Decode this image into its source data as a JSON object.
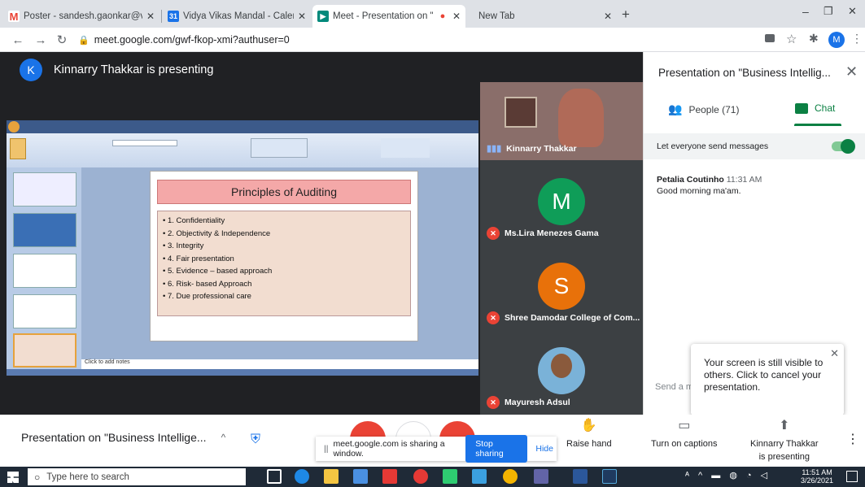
{
  "browser": {
    "tabs": [
      {
        "title": "Poster - sandesh.gaonkar@vvm.e",
        "icon": "gmail-icon"
      },
      {
        "title": "Vidya Vikas Mandal - Calendar -",
        "icon": "calendar-icon"
      },
      {
        "title": "Meet - Presentation on \"Busi",
        "icon": "meet-icon"
      },
      {
        "title": "New Tab",
        "icon": ""
      }
    ],
    "url": "meet.google.com/gwf-fkop-xmi?authuser=0",
    "profile_initial": "M"
  },
  "stage": {
    "presenting_initial": "K",
    "presenting_label": "Kinnarry Thakkar is presenting"
  },
  "slide": {
    "title": "Principles of Auditing",
    "bullets": [
      "• 1. Confidentiality",
      "• 2. Objectivity & Independence",
      "• 3. Integrity",
      "• 4. Fair presentation",
      "• 5. Evidence – based approach",
      "• 6. Risk- based Approach",
      "• 7. Due professional care"
    ],
    "notes": "Click to add notes"
  },
  "participants": [
    {
      "name": "Kinnarry Thakkar",
      "initial": "",
      "color": ""
    },
    {
      "name": "Ms.Lira Menezes Gama",
      "initial": "M",
      "color": "#0f9d58"
    },
    {
      "name": "Shree Damodar College of Com...",
      "initial": "S",
      "color": "#e8710a"
    },
    {
      "name": "Mayuresh Adsul",
      "initial": "",
      "color": ""
    }
  ],
  "panel": {
    "title": "Presentation on \"Business Intellig...",
    "people_tab": "People (71)",
    "chat_tab": "Chat",
    "allow_label": "Let everyone send messages",
    "message": {
      "sender": "Petalia Coutinho",
      "time": "11:31 AM",
      "text": "Good morning ma'am."
    },
    "send_placeholder": "Send a m"
  },
  "toast": {
    "text": "Your screen is still visible to others. Click to cancel your presentation."
  },
  "bottom": {
    "meeting_title": "Presentation on \"Business Intellige...",
    "sharing_text": "meet.google.com is sharing a window.",
    "stop_sharing": "Stop sharing",
    "hide": "Hide",
    "raise_hand": "Raise hand",
    "captions": "Turn on captions",
    "presenting_line1": "Kinnarry Thakkar",
    "presenting_line2": "is presenting"
  },
  "taskbar": {
    "search_placeholder": "Type here to search",
    "time": "11:51 AM",
    "date": "3/26/2021"
  }
}
